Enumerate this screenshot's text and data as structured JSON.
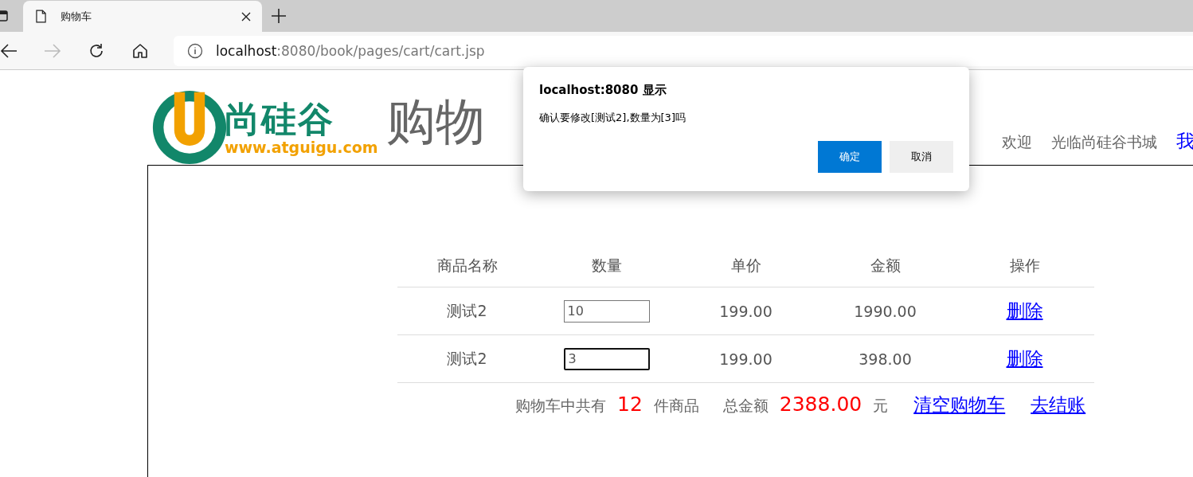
{
  "browser": {
    "tab": {
      "title": "购物车"
    },
    "address": {
      "host": "localhost",
      "path": ":8080/book/pages/cart/cart.jsp"
    }
  },
  "header": {
    "logo_name": "尚硅谷",
    "logo_url": "www.atguigu.com",
    "title": "购物",
    "welcome": [
      "欢迎",
      "光临尚硅谷书城"
    ],
    "link": "我"
  },
  "table": {
    "columns": [
      "商品名称",
      "数量",
      "单价",
      "金额",
      "操作"
    ],
    "rows": [
      {
        "name": "测试2",
        "quantity": "10",
        "focused": false,
        "price": "199.00",
        "amount": "1990.00",
        "action": "删除"
      },
      {
        "name": "测试2",
        "quantity": "3",
        "focused": true,
        "price": "199.00",
        "amount": "398.00",
        "action": "删除"
      }
    ]
  },
  "summary": {
    "count_label": "购物车中共有",
    "count": "12",
    "count_unit": "件商品",
    "total_label": "总金额",
    "total": "2388.00",
    "total_unit": "元",
    "clear": "清空购物车",
    "checkout": "去结账"
  },
  "dialog": {
    "title": "localhost:8080 显示",
    "message": "确认要修改[测试2],数量为[3]吗",
    "buttons": [
      {
        "label": "确定",
        "kind": "primary"
      },
      {
        "label": "取消",
        "kind": "secondary"
      }
    ]
  }
}
